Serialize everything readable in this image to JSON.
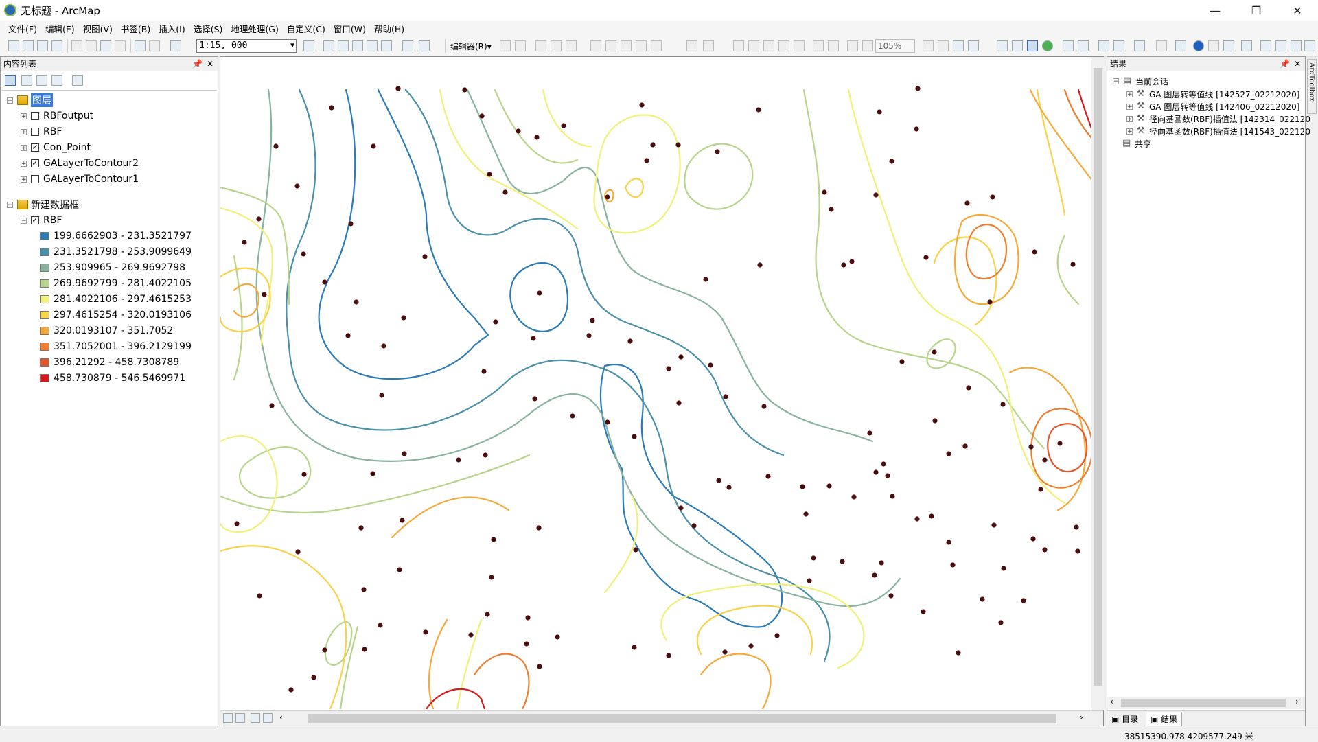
{
  "window": {
    "title": "无标题 - ArcMap",
    "minimize": "—",
    "maximize": "❐",
    "close": "✕"
  },
  "menu": [
    "文件(F)",
    "编辑(E)",
    "视图(V)",
    "书签(B)",
    "插入(I)",
    "选择(S)",
    "地理处理(G)",
    "自定义(C)",
    "窗口(W)",
    "帮助(H)"
  ],
  "toolbar": {
    "scale": "1:15, 000",
    "editor": "编辑器(R)▾",
    "zoom": "105%"
  },
  "toc": {
    "title": "内容列表",
    "group1": {
      "name": "图层",
      "layers": [
        {
          "name": "RBFoutput",
          "checked": false
        },
        {
          "name": "RBF",
          "checked": false
        },
        {
          "name": "Con_Point",
          "checked": true
        },
        {
          "name": "GALayerToContour2",
          "checked": true
        },
        {
          "name": "GALayerToContour1",
          "checked": false
        }
      ]
    },
    "group2": {
      "name": "新建数据框",
      "layer": "RBF"
    },
    "legend": [
      {
        "label": "199.6662903 - 231.3521797",
        "color": "#2c7bb6"
      },
      {
        "label": "231.3521798 - 253.9099649",
        "color": "#4a90a8"
      },
      {
        "label": "253.909965 - 269.9692798",
        "color": "#87b39f"
      },
      {
        "label": "269.9692799 - 281.4022105",
        "color": "#b8d48a"
      },
      {
        "label": "281.4022106 - 297.4615253",
        "color": "#f0f07a"
      },
      {
        "label": "297.4615254 - 320.0193106",
        "color": "#f8d24a"
      },
      {
        "label": "320.0193107 - 351.7052",
        "color": "#f4a93a"
      },
      {
        "label": "351.7052001 - 396.2129199",
        "color": "#ee7d2e"
      },
      {
        "label": "396.21292 - 458.7308789",
        "color": "#e5552a"
      },
      {
        "label": "458.730879 - 546.5469971",
        "color": "#d7191c"
      }
    ]
  },
  "results": {
    "title": "结果",
    "session": "当前会话",
    "items": [
      "GA 图层转等值线 [142527_02212020]",
      "GA 图层转等值线 [142406_02212020]",
      "径向基函数(RBF)插值法 [142314_022120",
      "径向基函数(RBF)插值法 [141543_022120"
    ],
    "shared": "共享",
    "tab_catalog": "目录",
    "tab_results": "结果"
  },
  "side_tab": "ArcToolbox",
  "status": {
    "coords": "38515390.978  4209577.249 米"
  }
}
